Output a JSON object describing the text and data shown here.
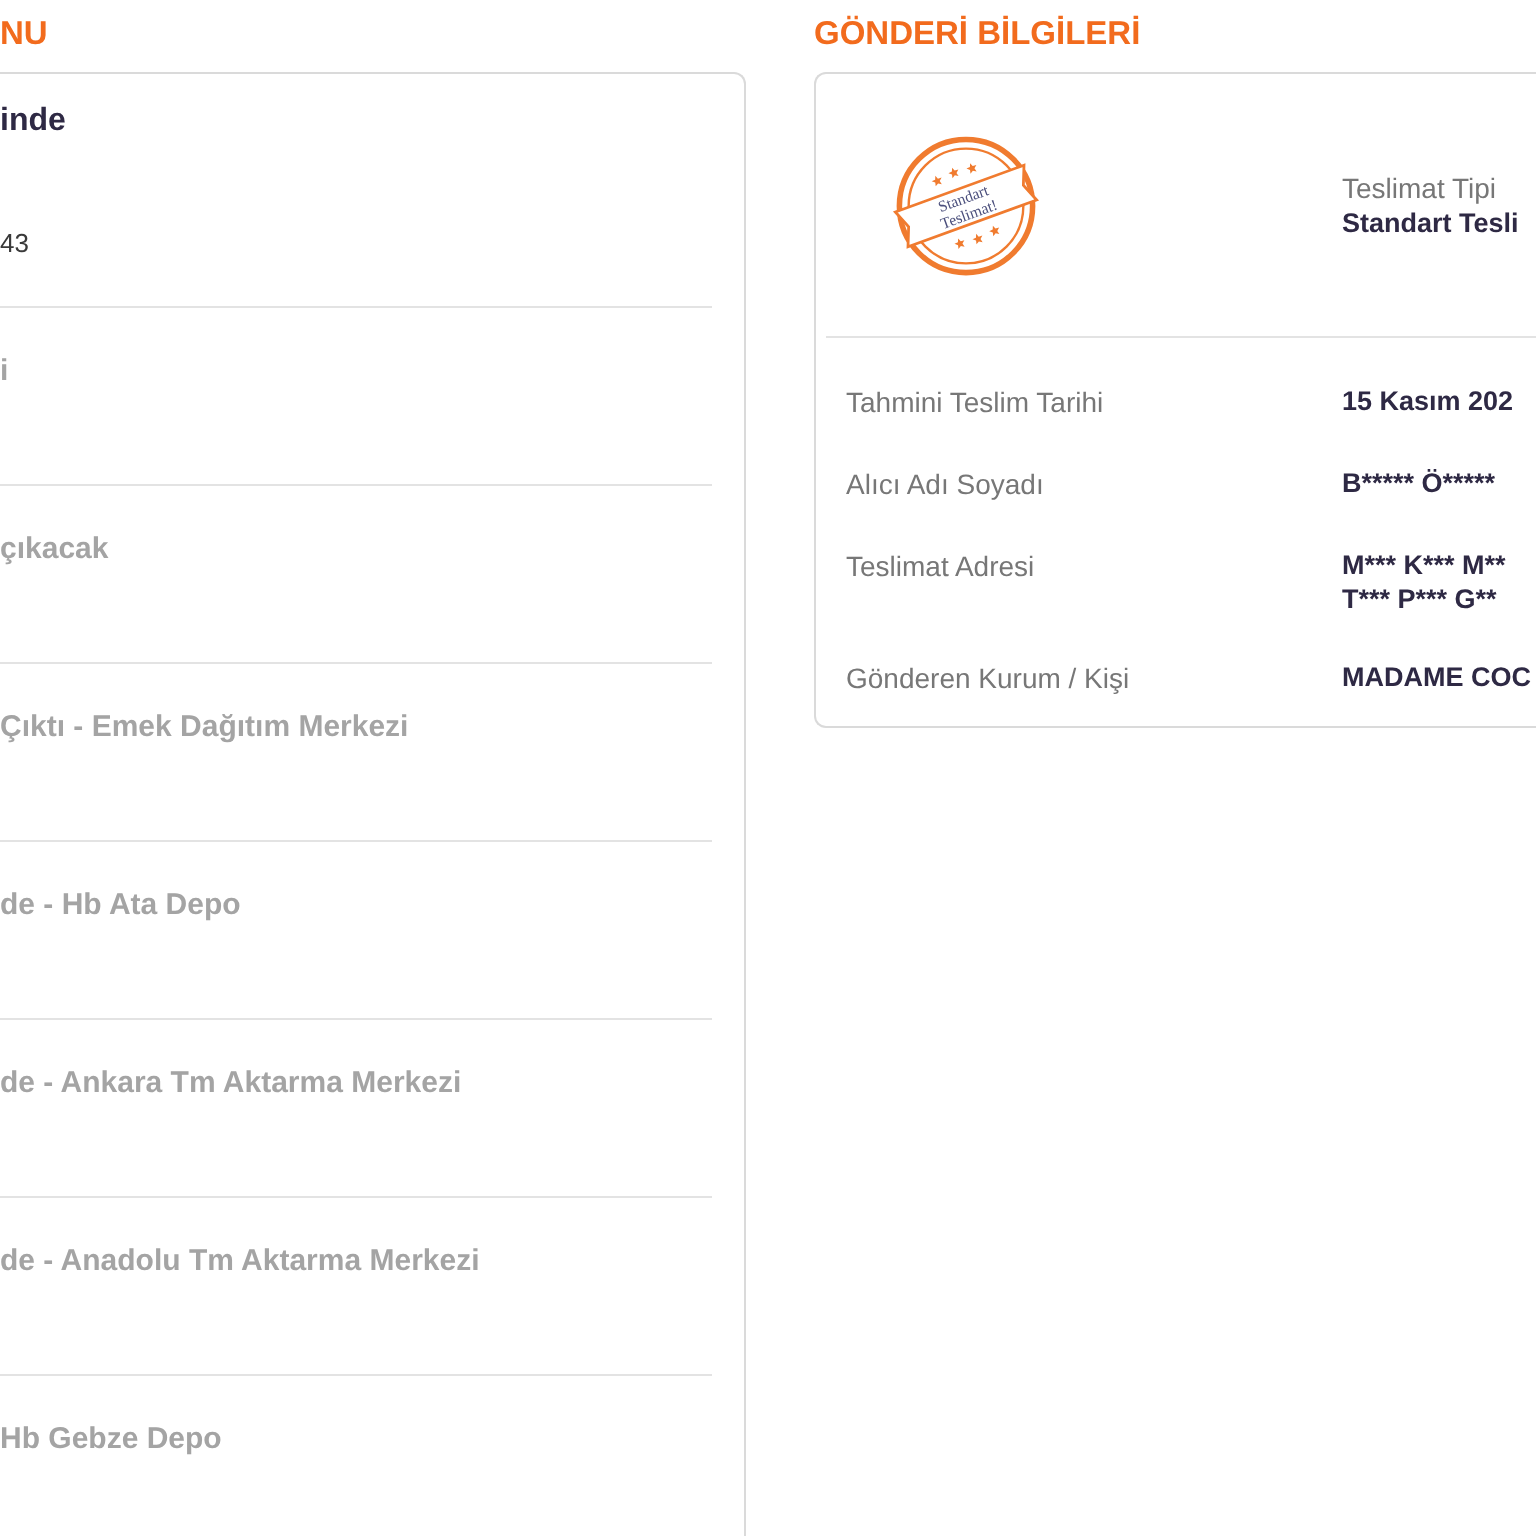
{
  "tracking": {
    "heading": "NU",
    "steps": [
      {
        "title": "inde",
        "detail": "43",
        "current": true
      },
      {
        "title": "i",
        "current": false
      },
      {
        "title": "çıkacak",
        "current": false
      },
      {
        "title": "Çıktı - Emek Dağıtım Merkezi",
        "current": false
      },
      {
        "title": "de - Hb Ata Depo",
        "current": false
      },
      {
        "title": "de - Ankara Tm Aktarma Merkezi",
        "current": false
      },
      {
        "title": "de - Anadolu Tm Aktarma Merkezi",
        "current": false
      },
      {
        "title": "Hb Gebze Depo",
        "current": false
      }
    ]
  },
  "shipment": {
    "heading": "GÖNDERİ BİLGİLERİ",
    "stamp": {
      "lines": [
        "Standart",
        "Teslimat!"
      ]
    },
    "delivery_type": {
      "label": "Teslimat Tipi",
      "value": "Standart Tesli"
    },
    "fields": [
      {
        "label": "Tahmini Teslim Tarihi",
        "value_lines": [
          "15 Kasım 202"
        ]
      },
      {
        "label": "Alıcı Adı Soyadı",
        "value_lines": [
          "B***** Ö*****"
        ]
      },
      {
        "label": "Teslimat Adresi",
        "value_lines": [
          "M*** K*** M**",
          "T*** P*** G**"
        ]
      },
      {
        "label": "Gönderen Kurum / Kişi",
        "value_lines": [
          "MADAME COC"
        ]
      }
    ]
  }
}
